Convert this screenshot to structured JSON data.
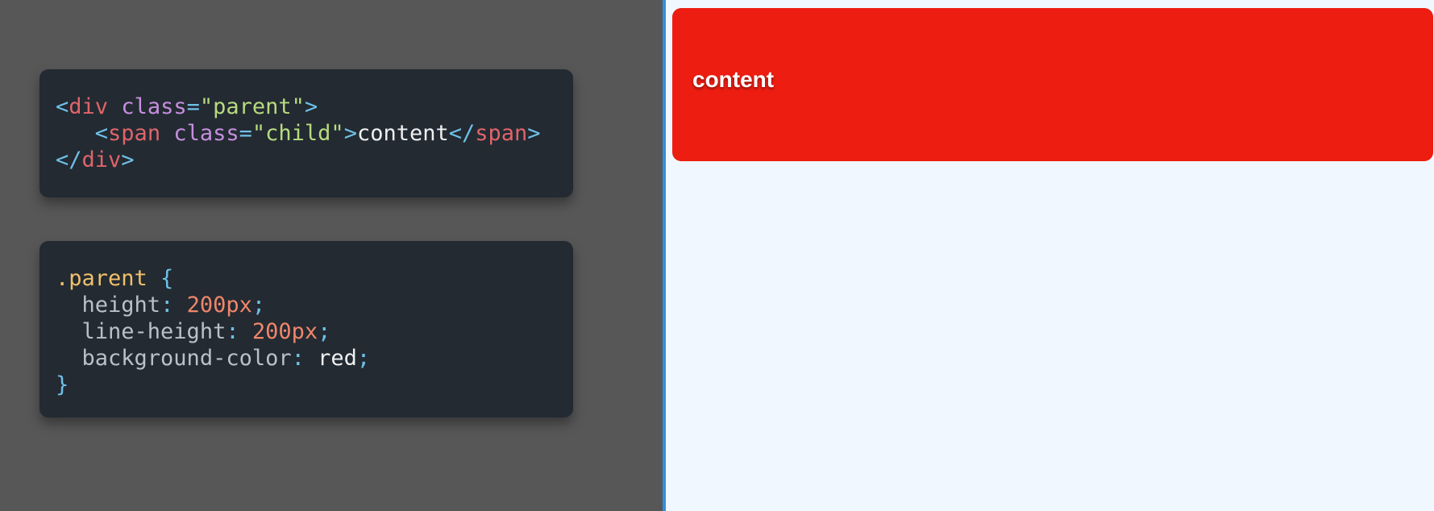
{
  "html_code": {
    "line1": {
      "open": "<",
      "tag": "div",
      "space": " ",
      "attr": "class",
      "eq": "=",
      "value": "\"parent\"",
      "close": ">"
    },
    "line2": {
      "indent": "   ",
      "open": "<",
      "tag": "span",
      "space": " ",
      "attr": "class",
      "eq": "=",
      "value": "\"child\"",
      "close": ">",
      "text": "content",
      "end_open": "</",
      "end_tag": "span",
      "end_close": ">"
    },
    "line3": {
      "open": "</",
      "tag": "div",
      "close": ">"
    }
  },
  "css_code": {
    "selector": ".parent",
    "brace_open": " {",
    "declarations": [
      {
        "indent": "  ",
        "property": "height",
        "colon": ": ",
        "value": "200px",
        "semi": ";"
      },
      {
        "indent": "  ",
        "property": "line-height",
        "colon": ": ",
        "value": "200px",
        "semi": ";"
      },
      {
        "indent": "  ",
        "property": "background-color",
        "colon": ": ",
        "value": "red",
        "semi": ";"
      }
    ],
    "brace_close": "}"
  },
  "preview": {
    "child_text": "content"
  },
  "colors": {
    "editor_background": "#575757",
    "code_card_background": "#232a32",
    "preview_background": "#f0f7fe",
    "divider": "#2f8fd8",
    "parent_background": "#ed1d11"
  }
}
